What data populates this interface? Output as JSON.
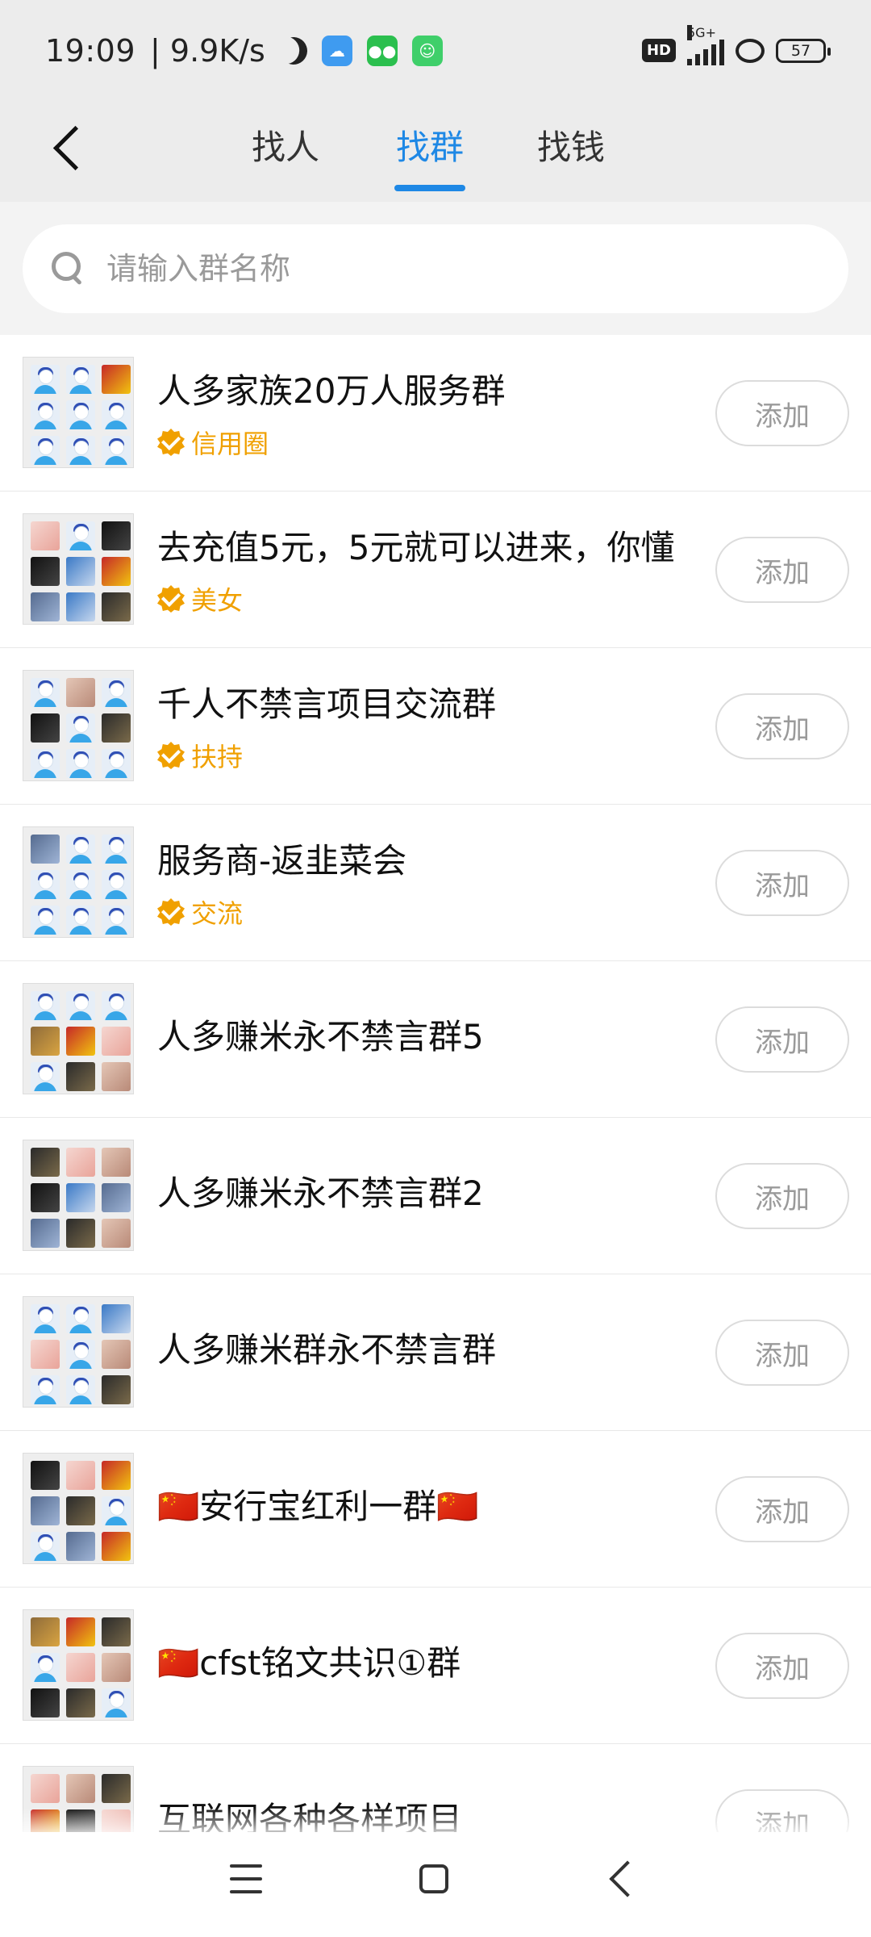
{
  "status": {
    "time": "19:09",
    "net_speed": "| 9.9K/s",
    "hd": "HD",
    "network": "5G+",
    "battery": "57"
  },
  "nav": {
    "tabs": [
      {
        "label": "找人",
        "active": false
      },
      {
        "label": "找群",
        "active": true
      },
      {
        "label": "找钱",
        "active": false
      }
    ]
  },
  "search": {
    "placeholder": "请输入群名称",
    "value": ""
  },
  "groups": [
    {
      "name": "人多家族20万人服务群",
      "tag": "信用圈",
      "add": "添加"
    },
    {
      "name": "去充值5元，5元就可以进来，你懂",
      "tag": "美女",
      "add": "添加"
    },
    {
      "name": "千人不禁言项目交流群",
      "tag": "扶持",
      "add": "添加"
    },
    {
      "name": "服务商-返韭菜会",
      "tag": "交流",
      "add": "添加"
    },
    {
      "name": "人多赚米永不禁言群5",
      "tag": "",
      "add": "添加"
    },
    {
      "name": "人多赚米永不禁言群2",
      "tag": "",
      "add": "添加"
    },
    {
      "name": "人多赚米群永不禁言群",
      "tag": "",
      "add": "添加"
    },
    {
      "name": "🇨🇳安行宝红利一群🇨🇳",
      "tag": "",
      "add": "添加"
    },
    {
      "name": "🇨🇳cfst铭文共识①群",
      "tag": "",
      "add": "添加"
    },
    {
      "name": "互联网各种各样项目",
      "tag": "",
      "add": "添加"
    }
  ],
  "colors": {
    "accent": "#1e88e5",
    "tag": "#f0a000",
    "header_bg": "#ececec"
  }
}
